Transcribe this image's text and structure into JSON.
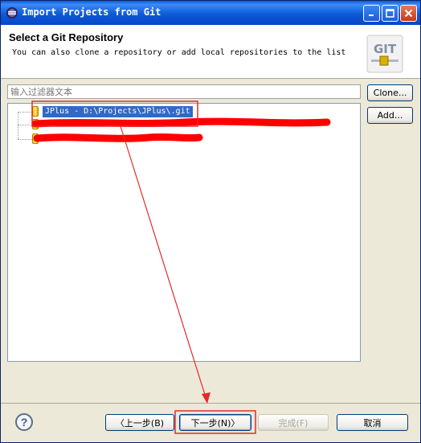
{
  "window": {
    "title": "Import Projects from Git",
    "controls": {
      "minimize": "minimize",
      "maximize": "maximize",
      "close": "close"
    }
  },
  "header": {
    "title": "Select a Git Repository",
    "description": "You can also clone a repository or add local repositories to the list",
    "logo_text": "GIT"
  },
  "filter": {
    "placeholder": "输入过滤器文本",
    "value": ""
  },
  "side_buttons": {
    "clone": "Clone...",
    "add": "Add..."
  },
  "tree": {
    "items": [
      {
        "label": "JPlus - D:\\Projects\\JPlus\\.git",
        "selected": true,
        "redacted": false
      },
      {
        "label": "",
        "selected": false,
        "redacted": true
      },
      {
        "label": "",
        "selected": false,
        "redacted": true
      }
    ]
  },
  "footer": {
    "help_icon": "?",
    "back": "〈上一步(B)",
    "next": "下一步(N)〉",
    "finish": "完成(F)",
    "cancel": "取消"
  },
  "colors": {
    "title_blue": "#0a5bd8",
    "selection": "#316ac5",
    "annotation_red": "#e32b2b",
    "redaction_red": "#ff0000"
  }
}
